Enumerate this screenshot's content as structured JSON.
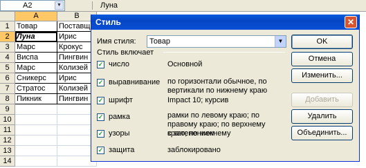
{
  "formula_bar": {
    "cell_ref": "A2",
    "content": "Луна"
  },
  "columns": [
    "A",
    "B"
  ],
  "rows": [
    {
      "num": "1",
      "a": "Товар",
      "b": "Поставщи"
    },
    {
      "num": "2",
      "a": "Луна",
      "b": "Ирис"
    },
    {
      "num": "3",
      "a": "Марс",
      "b": "Крокус"
    },
    {
      "num": "4",
      "a": "Виспа",
      "b": "Пингвин"
    },
    {
      "num": "5",
      "a": "Марс",
      "b": "Колизей"
    },
    {
      "num": "6",
      "a": "Сникерс",
      "b": "Ирис"
    },
    {
      "num": "7",
      "a": "Стратос",
      "b": "Колизей"
    },
    {
      "num": "8",
      "a": "Пикник",
      "b": "Пингвин"
    },
    {
      "num": "9",
      "a": "",
      "b": ""
    },
    {
      "num": "10",
      "a": "",
      "b": ""
    },
    {
      "num": "11",
      "a": "",
      "b": ""
    },
    {
      "num": "12",
      "a": "",
      "b": ""
    },
    {
      "num": "13",
      "a": "",
      "b": ""
    },
    {
      "num": "14",
      "a": "",
      "b": ""
    }
  ],
  "dialog": {
    "title": "Стиль",
    "style_name_label": "Имя стиля:",
    "style_name_value": "Товар",
    "includes_label": "Стиль включает",
    "items": [
      {
        "label": "число",
        "checked": true,
        "desc": "Основной"
      },
      {
        "label": "выравнивание",
        "checked": true,
        "desc": "по горизонтали обычное, по вертикали по нижнему краю"
      },
      {
        "label": "шрифт",
        "checked": true,
        "desc": "Impact 10; курсив"
      },
      {
        "label": "рамка",
        "checked": true,
        "desc": "рамки по левому краю; по правому краю; по верхнему краю; по нижнему"
      },
      {
        "label": "узоры",
        "checked": true,
        "desc": "с затенением"
      },
      {
        "label": "защита",
        "checked": true,
        "desc": "заблокировано"
      }
    ],
    "buttons": {
      "ok": "OK",
      "cancel": "Отмена",
      "modify": "Изменить...",
      "add": "Добавить",
      "delete": "Удалить",
      "merge": "Объединить..."
    }
  }
}
